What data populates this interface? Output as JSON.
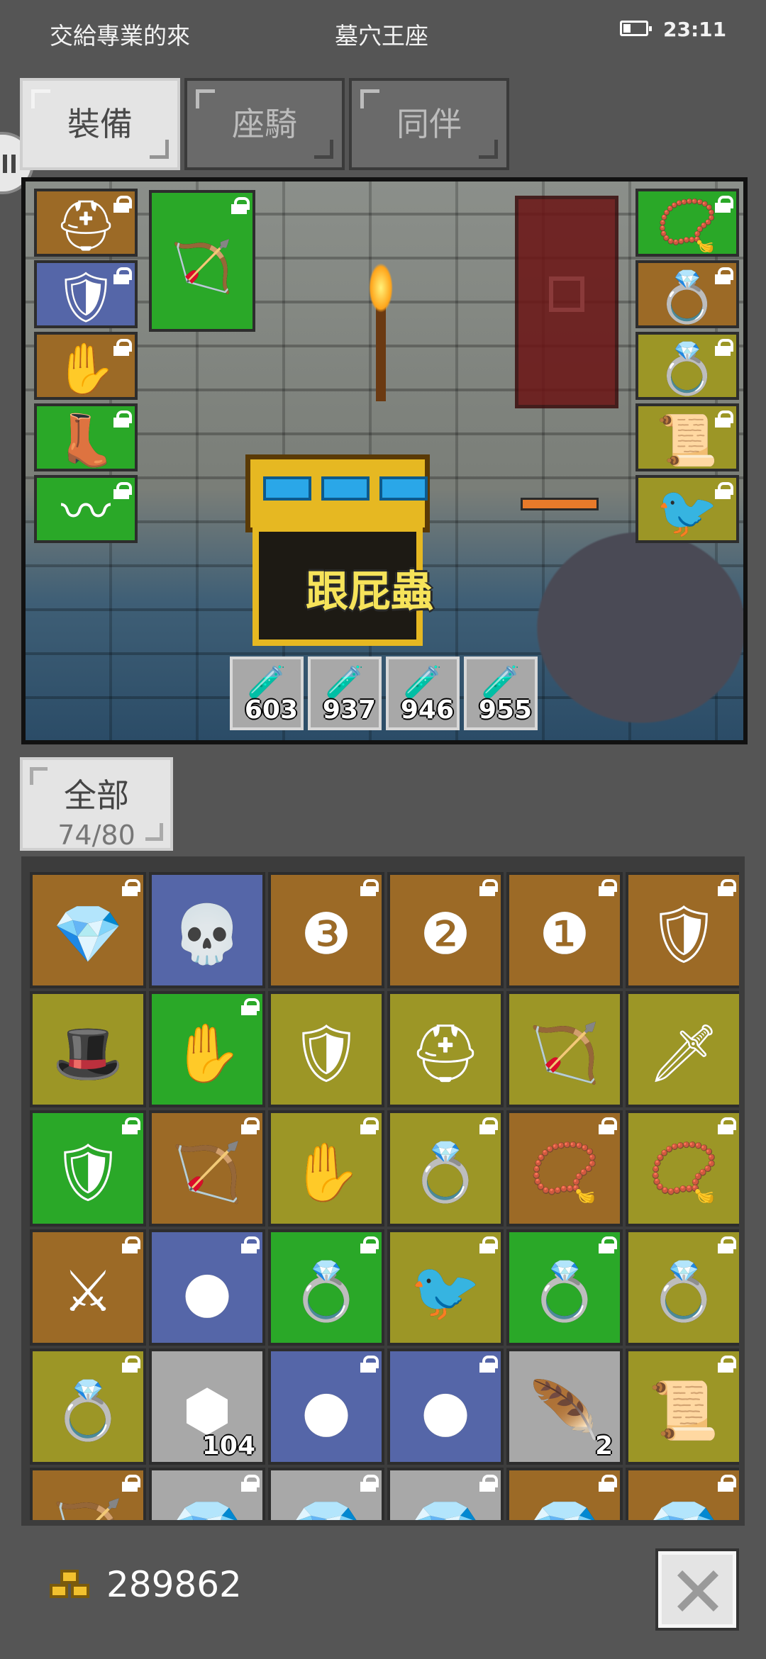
{
  "status_bar": {
    "left_text": "交給專業的來",
    "center_text": "墓穴王座",
    "time": "23:11"
  },
  "tabs": [
    {
      "label": "裝備",
      "active": true
    },
    {
      "label": "座騎",
      "active": false
    },
    {
      "label": "同伴",
      "active": false
    }
  ],
  "equipment": {
    "chest_label": "跟屁蟲",
    "left_slots": [
      {
        "icon": "helmet-icon",
        "color": "#9c6a26"
      },
      {
        "icon": "armor-icon",
        "color": "#5566a8"
      },
      {
        "icon": "glove-icon",
        "color": "#9c6a26"
      },
      {
        "icon": "boots-icon",
        "color": "#2aa828"
      },
      {
        "icon": "belt-icon",
        "color": "#2aa828"
      }
    ],
    "weapon_slot": {
      "icon": "bow-icon",
      "color": "#2aa828"
    },
    "right_slots": [
      {
        "icon": "amulet-icon",
        "color": "#2aa828"
      },
      {
        "icon": "ring-icon",
        "color": "#9c6a26"
      },
      {
        "icon": "ring-icon",
        "color": "#9c9626"
      },
      {
        "icon": "scroll-icon",
        "color": "#9c9626"
      },
      {
        "icon": "bird-icon",
        "color": "#9c9626"
      }
    ],
    "potions": [
      {
        "icon": "potion-icon",
        "count": "603"
      },
      {
        "icon": "potion-icon",
        "count": "937"
      },
      {
        "icon": "potion-icon",
        "count": "946"
      },
      {
        "icon": "potion-icon",
        "count": "955"
      }
    ]
  },
  "filter": {
    "label": "全部",
    "capacity": "74/80"
  },
  "inventory": [
    {
      "icon": "gem-icon",
      "color": "#9c6a26",
      "lock": true
    },
    {
      "icon": "skull-icon",
      "color": "#5566a8",
      "lock": false
    },
    {
      "icon": "rune-stone-3-icon",
      "color": "#9c6a26",
      "lock": true
    },
    {
      "icon": "rune-stone-2-icon",
      "color": "#9c6a26",
      "lock": true
    },
    {
      "icon": "rune-stone-1-icon",
      "color": "#9c6a26",
      "lock": true
    },
    {
      "icon": "armor-icon",
      "color": "#9c6a26",
      "lock": true
    },
    {
      "icon": "hat-icon",
      "color": "#9c9626",
      "lock": false
    },
    {
      "icon": "glove-icon",
      "color": "#2aa828",
      "lock": true
    },
    {
      "icon": "armor-icon",
      "color": "#9c9626",
      "lock": false
    },
    {
      "icon": "helmet-icon",
      "color": "#9c9626",
      "lock": false
    },
    {
      "icon": "bow-icon",
      "color": "#9c9626",
      "lock": false
    },
    {
      "icon": "dagger-icon",
      "color": "#9c9626",
      "lock": false
    },
    {
      "icon": "armor-icon",
      "color": "#2aa828",
      "lock": true
    },
    {
      "icon": "bow-icon",
      "color": "#9c6a26",
      "lock": true
    },
    {
      "icon": "glove-icon",
      "color": "#9c9626",
      "lock": true
    },
    {
      "icon": "ring-icon",
      "color": "#9c9626",
      "lock": true
    },
    {
      "icon": "amulet-icon",
      "color": "#9c6a26",
      "lock": true
    },
    {
      "icon": "amulet-icon",
      "color": "#9c9626",
      "lock": true
    },
    {
      "icon": "sword-icon",
      "color": "#9c6a26",
      "lock": true
    },
    {
      "icon": "orb-icon",
      "color": "#5566a8",
      "lock": true
    },
    {
      "icon": "ring-icon",
      "color": "#2aa828",
      "lock": true
    },
    {
      "icon": "bird-icon",
      "color": "#9c9626",
      "lock": true
    },
    {
      "icon": "ring-icon",
      "color": "#2aa828",
      "lock": true
    },
    {
      "icon": "ring-icon",
      "color": "#9c9626",
      "lock": true
    },
    {
      "icon": "ring-icon",
      "color": "#9c9626",
      "lock": true
    },
    {
      "icon": "ore-icon",
      "color": "#a8a8a8",
      "lock": false,
      "count": "104"
    },
    {
      "icon": "orb-icon",
      "color": "#5566a8",
      "lock": true
    },
    {
      "icon": "orb-icon",
      "color": "#5566a8",
      "lock": true
    },
    {
      "icon": "feather-icon",
      "color": "#a8a8a8",
      "lock": false,
      "count": "2"
    },
    {
      "icon": "scroll-icon",
      "color": "#9c9626",
      "lock": true
    },
    {
      "icon": "bow-icon",
      "color": "#9c6a26",
      "lock": true
    },
    {
      "icon": "gem-icon",
      "color": "#a8a8a8",
      "lock": true
    },
    {
      "icon": "gem-icon",
      "color": "#a8a8a8",
      "lock": true
    },
    {
      "icon": "gem-icon",
      "color": "#a8a8a8",
      "lock": true
    },
    {
      "icon": "gem-icon",
      "color": "#9c6a26",
      "lock": true
    },
    {
      "icon": "gem-icon",
      "color": "#9c6a26",
      "lock": true
    }
  ],
  "gold": {
    "icon": "gold-icon",
    "amount": "289862"
  },
  "close": {
    "icon": "close-icon"
  }
}
